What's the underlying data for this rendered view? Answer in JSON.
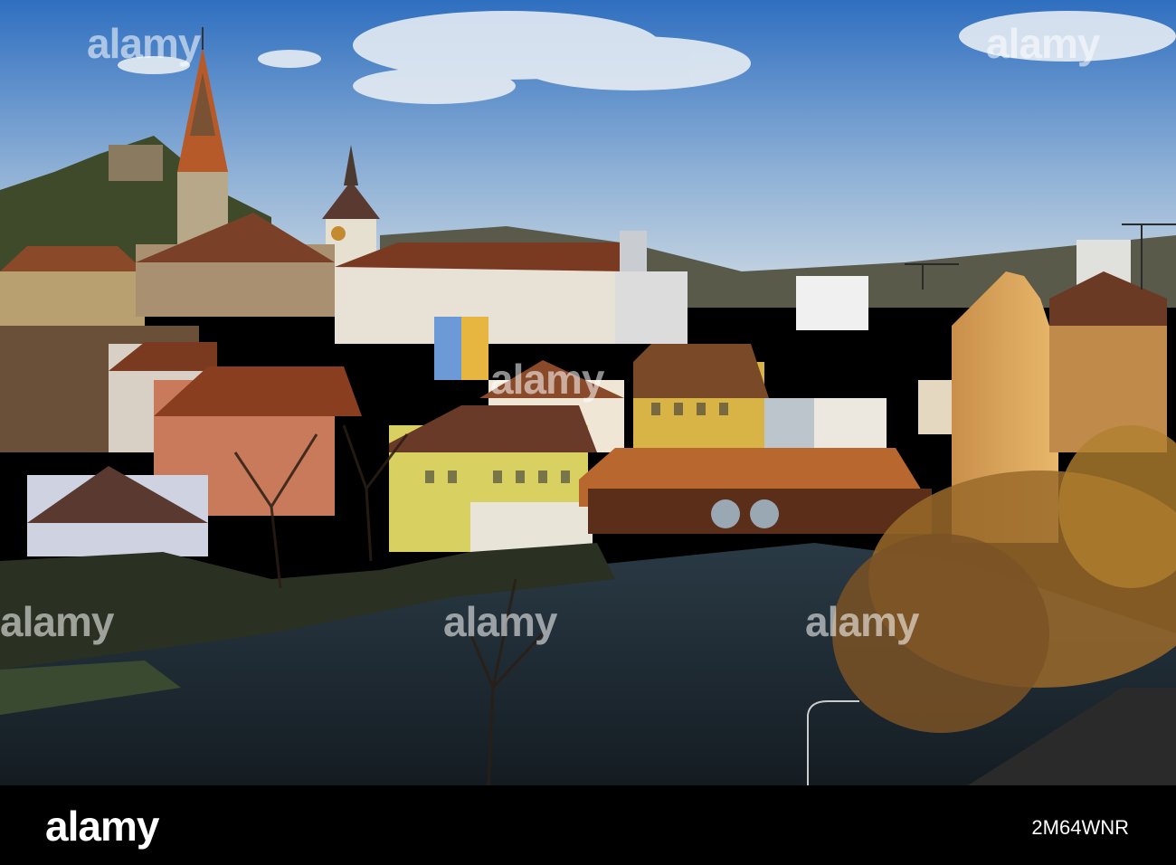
{
  "watermark": {
    "text": "alamy"
  },
  "footer": {
    "logo": "alamy",
    "image_code": "2M64WNR"
  },
  "colors": {
    "sky_top": "#2f6fc0",
    "sky_bottom": "#b9cde0",
    "river": "#1e2a33",
    "roof": "#8a4a2a",
    "sunlit_wall": "#d9a35a",
    "footer_bg": "#000000"
  }
}
